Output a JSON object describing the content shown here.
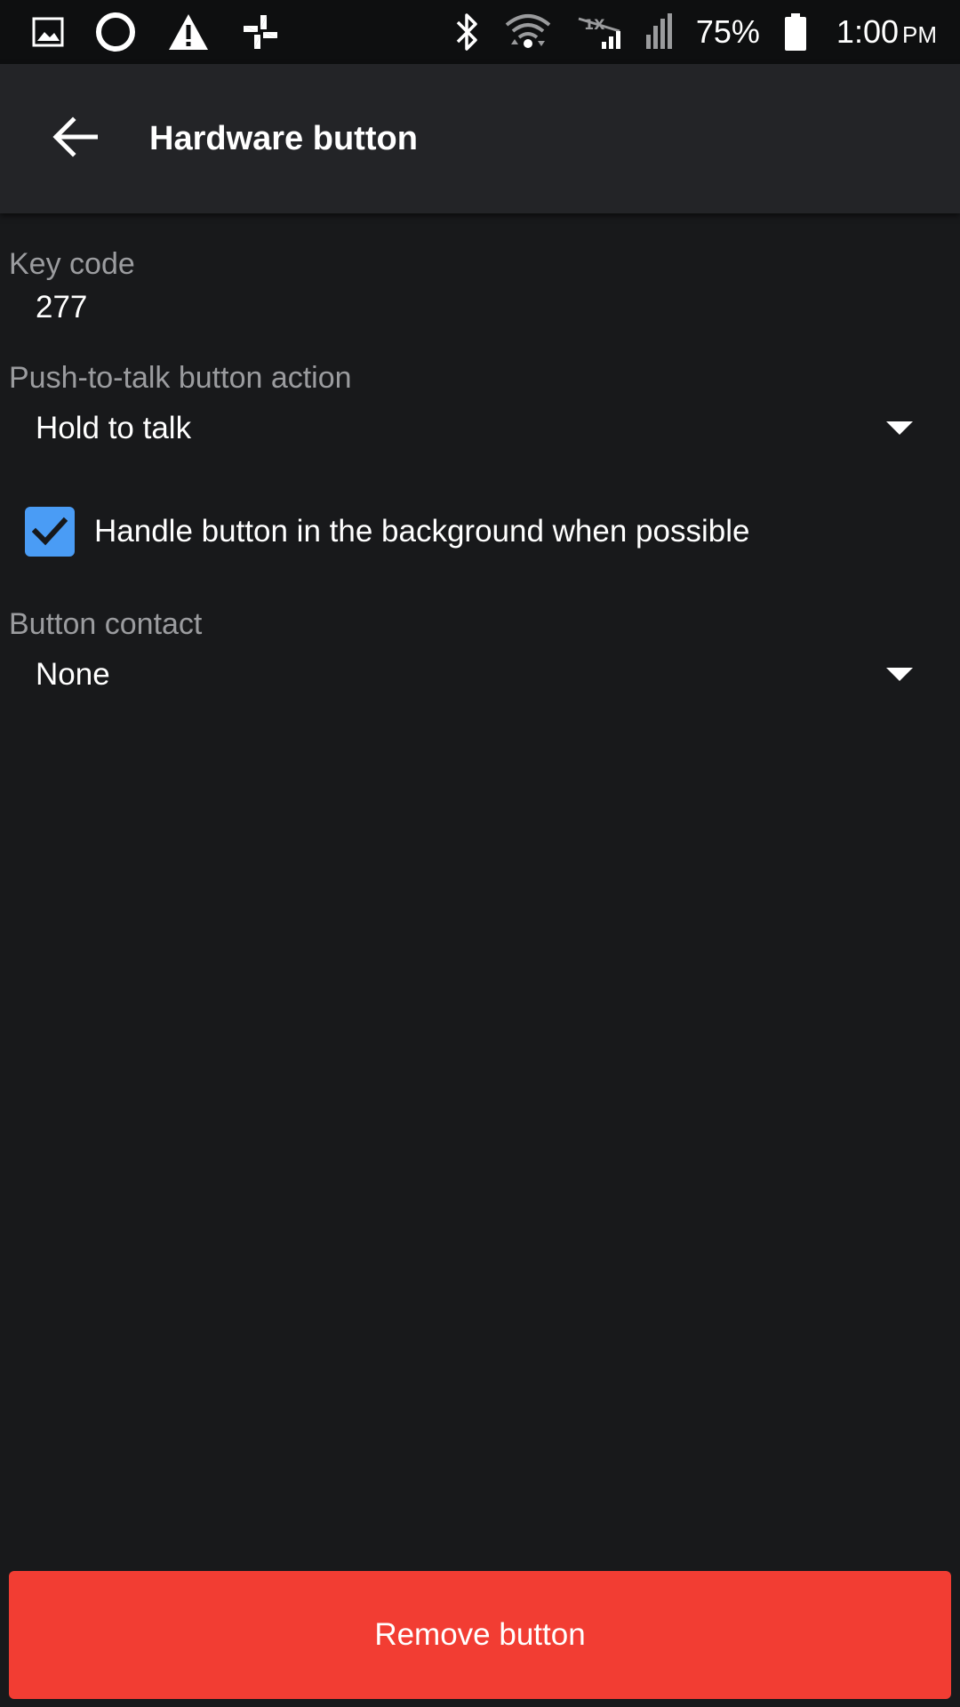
{
  "status_bar": {
    "left_icons": [
      "gallery-icon",
      "circle-icon",
      "warning-icon",
      "pinwheel-icon"
    ],
    "right_icons": [
      "bluetooth-icon",
      "wifi-icon",
      "no-sim-icon",
      "signal-icon",
      "battery-icon"
    ],
    "battery_percent": "75%",
    "time": "1:00",
    "ampm": "PM"
  },
  "app_bar": {
    "back_icon": "arrow-back-icon",
    "title": "Hardware button"
  },
  "form": {
    "key_code_label": "Key code",
    "key_code_value": "277",
    "ptt_action_label": "Push-to-talk button action",
    "ptt_action_value": "Hold to talk",
    "background_checkbox_label": "Handle button in the background when possible",
    "background_checkbox_checked": true,
    "button_contact_label": "Button contact",
    "button_contact_value": "None"
  },
  "footer": {
    "remove_label": "Remove button"
  },
  "colors": {
    "background": "#18191b",
    "app_bar": "#232427",
    "status_bar": "#0e0f10",
    "label_gray": "#9b9c9f",
    "checkbox_blue": "#4a9cf5",
    "remove_red": "#f23d33"
  }
}
